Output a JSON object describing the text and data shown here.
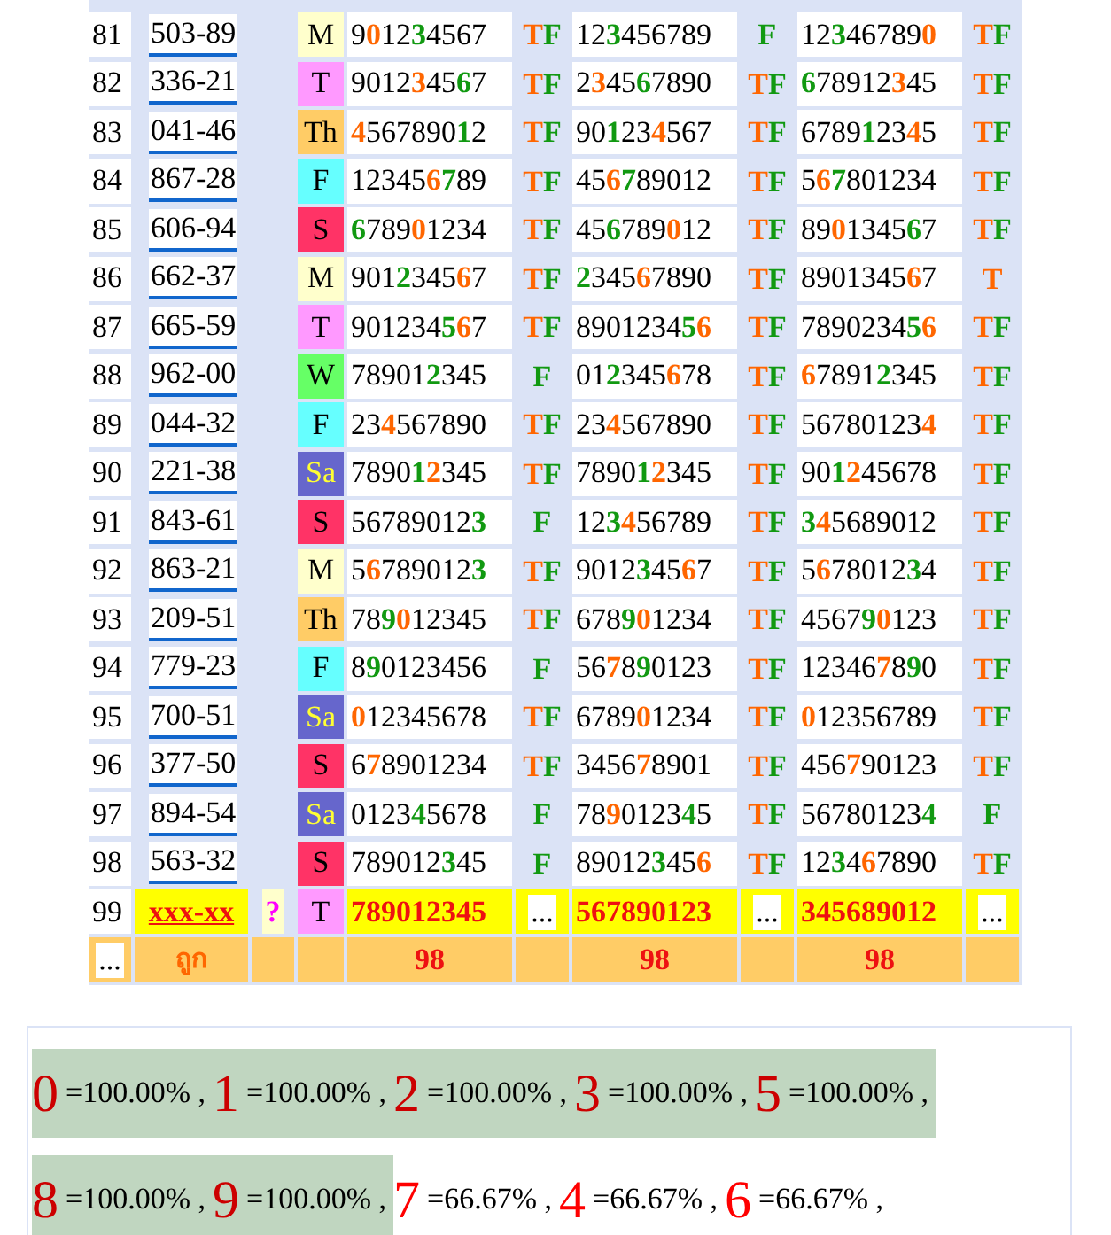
{
  "rows": [
    {
      "no": "81",
      "num": "503-89",
      "day": "M",
      "color": "#ffffcc",
      "nums": [
        [
          {
            "text": "9",
            "kind": "plain"
          },
          {
            "text": "0",
            "kind": "hot"
          },
          {
            "text": "12",
            "kind": "plain"
          },
          {
            "text": "3",
            "kind": "cold"
          },
          {
            "text": "4567",
            "kind": "plain"
          }
        ],
        [
          {
            "text": "12",
            "kind": "plain"
          },
          {
            "text": "3",
            "kind": "cold"
          },
          {
            "text": "456789",
            "kind": "plain"
          }
        ],
        [
          {
            "text": "12",
            "kind": "plain"
          },
          {
            "text": "3",
            "kind": "cold"
          },
          {
            "text": "46789",
            "kind": "plain"
          },
          {
            "text": "0",
            "kind": "hot"
          }
        ]
      ],
      "marks": [
        {
          "t": "T",
          "f": "F"
        },
        {
          "f": "F"
        },
        {
          "t": "T",
          "f": "F"
        }
      ]
    },
    {
      "no": "82",
      "num": "336-21",
      "day": "T",
      "color": "#ff99ff",
      "nums": [
        [
          {
            "text": "9012",
            "kind": "plain"
          },
          {
            "text": "3",
            "kind": "hot"
          },
          {
            "text": "45",
            "kind": "plain"
          },
          {
            "text": "6",
            "kind": "cold"
          },
          {
            "text": "7",
            "kind": "plain"
          }
        ],
        [
          {
            "text": "2",
            "kind": "plain"
          },
          {
            "text": "3",
            "kind": "hot"
          },
          {
            "text": "45",
            "kind": "plain"
          },
          {
            "text": "6",
            "kind": "cold"
          },
          {
            "text": "7890",
            "kind": "plain"
          }
        ],
        [
          {
            "text": "6",
            "kind": "cold"
          },
          {
            "text": "78912",
            "kind": "plain"
          },
          {
            "text": "3",
            "kind": "hot"
          },
          {
            "text": "45",
            "kind": "plain"
          }
        ]
      ],
      "marks": [
        {
          "t": "T",
          "f": "F"
        },
        {
          "t": "T",
          "f": "F"
        },
        {
          "t": "T",
          "f": "F"
        }
      ]
    },
    {
      "no": "83",
      "num": "041-46",
      "day": "Th",
      "color": "#ffcc66",
      "nums": [
        [
          {
            "text": "4",
            "kind": "hot"
          },
          {
            "text": "567890",
            "kind": "plain"
          },
          {
            "text": "1",
            "kind": "cold"
          },
          {
            "text": "2",
            "kind": "plain"
          }
        ],
        [
          {
            "text": "90",
            "kind": "plain"
          },
          {
            "text": "1",
            "kind": "cold"
          },
          {
            "text": "23",
            "kind": "plain"
          },
          {
            "text": "4",
            "kind": "hot"
          },
          {
            "text": "567",
            "kind": "plain"
          }
        ],
        [
          {
            "text": "6789",
            "kind": "plain"
          },
          {
            "text": "1",
            "kind": "cold"
          },
          {
            "text": "23",
            "kind": "plain"
          },
          {
            "text": "4",
            "kind": "hot"
          },
          {
            "text": "5",
            "kind": "plain"
          }
        ]
      ],
      "marks": [
        {
          "t": "T",
          "f": "F"
        },
        {
          "t": "T",
          "f": "F"
        },
        {
          "t": "T",
          "f": "F"
        }
      ]
    },
    {
      "no": "84",
      "num": "867-28",
      "day": "F",
      "color": "#66ffff",
      "nums": [
        [
          {
            "text": "12345",
            "kind": "plain"
          },
          {
            "text": "6",
            "kind": "hot"
          },
          {
            "text": "7",
            "kind": "cold"
          },
          {
            "text": "89",
            "kind": "plain"
          }
        ],
        [
          {
            "text": "45",
            "kind": "plain"
          },
          {
            "text": "6",
            "kind": "hot"
          },
          {
            "text": "7",
            "kind": "cold"
          },
          {
            "text": "89012",
            "kind": "plain"
          }
        ],
        [
          {
            "text": "5",
            "kind": "plain"
          },
          {
            "text": "6",
            "kind": "hot"
          },
          {
            "text": "7",
            "kind": "cold"
          },
          {
            "text": "801234",
            "kind": "plain"
          }
        ]
      ],
      "marks": [
        {
          "t": "T",
          "f": "F"
        },
        {
          "t": "T",
          "f": "F"
        },
        {
          "t": "T",
          "f": "F"
        }
      ]
    },
    {
      "no": "85",
      "num": "606-94",
      "day": "S",
      "color": "#ff3366",
      "nums": [
        [
          {
            "text": "6",
            "kind": "cold"
          },
          {
            "text": "789",
            "kind": "plain"
          },
          {
            "text": "0",
            "kind": "hot"
          },
          {
            "text": "1234",
            "kind": "plain"
          }
        ],
        [
          {
            "text": "45",
            "kind": "plain"
          },
          {
            "text": "6",
            "kind": "cold"
          },
          {
            "text": "789",
            "kind": "plain"
          },
          {
            "text": "0",
            "kind": "hot"
          },
          {
            "text": "12",
            "kind": "plain"
          }
        ],
        [
          {
            "text": "89",
            "kind": "plain"
          },
          {
            "text": "0",
            "kind": "hot"
          },
          {
            "text": "1345",
            "kind": "plain"
          },
          {
            "text": "6",
            "kind": "cold"
          },
          {
            "text": "7",
            "kind": "plain"
          }
        ]
      ],
      "marks": [
        {
          "t": "T",
          "f": "F"
        },
        {
          "t": "T",
          "f": "F"
        },
        {
          "t": "T",
          "f": "F"
        }
      ]
    },
    {
      "no": "86",
      "num": "662-37",
      "day": "M",
      "color": "#ffffcc",
      "nums": [
        [
          {
            "text": "901",
            "kind": "plain"
          },
          {
            "text": "2",
            "kind": "cold"
          },
          {
            "text": "345",
            "kind": "plain"
          },
          {
            "text": "6",
            "kind": "hot"
          },
          {
            "text": "7",
            "kind": "plain"
          }
        ],
        [
          {
            "text": "2",
            "kind": "cold"
          },
          {
            "text": "345",
            "kind": "plain"
          },
          {
            "text": "6",
            "kind": "hot"
          },
          {
            "text": "7890",
            "kind": "plain"
          }
        ],
        [
          {
            "text": "8901345",
            "kind": "plain"
          },
          {
            "text": "6",
            "kind": "hot"
          },
          {
            "text": "7",
            "kind": "plain"
          }
        ]
      ],
      "marks": [
        {
          "t": "T",
          "f": "F"
        },
        {
          "t": "T",
          "f": "F"
        },
        {
          "t": "T"
        }
      ]
    },
    {
      "no": "87",
      "num": "665-59",
      "day": "T",
      "color": "#ff99ff",
      "nums": [
        [
          {
            "text": "901234",
            "kind": "plain"
          },
          {
            "text": "5",
            "kind": "cold"
          },
          {
            "text": "6",
            "kind": "hot"
          },
          {
            "text": "7",
            "kind": "plain"
          }
        ],
        [
          {
            "text": "8901234",
            "kind": "plain"
          },
          {
            "text": "5",
            "kind": "cold"
          },
          {
            "text": "6",
            "kind": "hot"
          }
        ],
        [
          {
            "text": "7890234",
            "kind": "plain"
          },
          {
            "text": "5",
            "kind": "cold"
          },
          {
            "text": "6",
            "kind": "hot"
          }
        ]
      ],
      "marks": [
        {
          "t": "T",
          "f": "F"
        },
        {
          "t": "T",
          "f": "F"
        },
        {
          "t": "T",
          "f": "F"
        }
      ]
    },
    {
      "no": "88",
      "num": "962-00",
      "day": "W",
      "color": "#66ff66",
      "nums": [
        [
          {
            "text": "78901",
            "kind": "plain"
          },
          {
            "text": "2",
            "kind": "cold"
          },
          {
            "text": "345",
            "kind": "plain"
          }
        ],
        [
          {
            "text": "01",
            "kind": "plain"
          },
          {
            "text": "2",
            "kind": "cold"
          },
          {
            "text": "345",
            "kind": "plain"
          },
          {
            "text": "6",
            "kind": "hot"
          },
          {
            "text": "78",
            "kind": "plain"
          }
        ],
        [
          {
            "text": "6",
            "kind": "hot"
          },
          {
            "text": "7891",
            "kind": "plain"
          },
          {
            "text": "2",
            "kind": "cold"
          },
          {
            "text": "345",
            "kind": "plain"
          }
        ]
      ],
      "marks": [
        {
          "f": "F"
        },
        {
          "t": "T",
          "f": "F"
        },
        {
          "t": "T",
          "f": "F"
        }
      ]
    },
    {
      "no": "89",
      "num": "044-32",
      "day": "F",
      "color": "#66ffff",
      "nums": [
        [
          {
            "text": "23",
            "kind": "plain"
          },
          {
            "text": "4",
            "kind": "hot"
          },
          {
            "text": "567890",
            "kind": "plain"
          }
        ],
        [
          {
            "text": "23",
            "kind": "plain"
          },
          {
            "text": "4",
            "kind": "hot"
          },
          {
            "text": "567890",
            "kind": "plain"
          }
        ],
        [
          {
            "text": "56780123",
            "kind": "plain"
          },
          {
            "text": "4",
            "kind": "hot"
          }
        ]
      ],
      "marks": [
        {
          "t": "T",
          "f": "F"
        },
        {
          "t": "T",
          "f": "F"
        },
        {
          "t": "T",
          "f": "F"
        }
      ]
    },
    {
      "no": "90",
      "num": "221-38",
      "day": "Sa",
      "color": "#6666cc",
      "nums": [
        [
          {
            "text": "7890",
            "kind": "plain"
          },
          {
            "text": "1",
            "kind": "cold"
          },
          {
            "text": "2",
            "kind": "hot"
          },
          {
            "text": "345",
            "kind": "plain"
          }
        ],
        [
          {
            "text": "7890",
            "kind": "plain"
          },
          {
            "text": "1",
            "kind": "cold"
          },
          {
            "text": "2",
            "kind": "hot"
          },
          {
            "text": "345",
            "kind": "plain"
          }
        ],
        [
          {
            "text": "90",
            "kind": "plain"
          },
          {
            "text": "1",
            "kind": "cold"
          },
          {
            "text": "2",
            "kind": "hot"
          },
          {
            "text": "45678",
            "kind": "plain"
          }
        ]
      ],
      "marks": [
        {
          "t": "T",
          "f": "F"
        },
        {
          "t": "T",
          "f": "F"
        },
        {
          "t": "T",
          "f": "F"
        }
      ]
    },
    {
      "no": "91",
      "num": "843-61",
      "day": "S",
      "color": "#ff3366",
      "nums": [
        [
          {
            "text": "56789012",
            "kind": "plain"
          },
          {
            "text": "3",
            "kind": "cold"
          }
        ],
        [
          {
            "text": "12",
            "kind": "plain"
          },
          {
            "text": "3",
            "kind": "cold"
          },
          {
            "text": "4",
            "kind": "hot"
          },
          {
            "text": "56789",
            "kind": "plain"
          }
        ],
        [
          {
            "text": "3",
            "kind": "cold"
          },
          {
            "text": "4",
            "kind": "hot"
          },
          {
            "text": "5689012",
            "kind": "plain"
          }
        ]
      ],
      "marks": [
        {
          "f": "F"
        },
        {
          "t": "T",
          "f": "F"
        },
        {
          "t": "T",
          "f": "F"
        }
      ]
    },
    {
      "no": "92",
      "num": "863-21",
      "day": "M",
      "color": "#ffffcc",
      "nums": [
        [
          {
            "text": "5",
            "kind": "plain"
          },
          {
            "text": "6",
            "kind": "hot"
          },
          {
            "text": "789012",
            "kind": "plain"
          },
          {
            "text": "3",
            "kind": "cold"
          }
        ],
        [
          {
            "text": "9012",
            "kind": "plain"
          },
          {
            "text": "3",
            "kind": "cold"
          },
          {
            "text": "45",
            "kind": "plain"
          },
          {
            "text": "6",
            "kind": "hot"
          },
          {
            "text": "7",
            "kind": "plain"
          }
        ],
        [
          {
            "text": "5",
            "kind": "plain"
          },
          {
            "text": "6",
            "kind": "hot"
          },
          {
            "text": "78012",
            "kind": "plain"
          },
          {
            "text": "3",
            "kind": "cold"
          },
          {
            "text": "4",
            "kind": "plain"
          }
        ]
      ],
      "marks": [
        {
          "t": "T",
          "f": "F"
        },
        {
          "t": "T",
          "f": "F"
        },
        {
          "t": "T",
          "f": "F"
        }
      ]
    },
    {
      "no": "93",
      "num": "209-51",
      "day": "Th",
      "color": "#ffcc66",
      "nums": [
        [
          {
            "text": "78",
            "kind": "plain"
          },
          {
            "text": "9",
            "kind": "cold"
          },
          {
            "text": "0",
            "kind": "hot"
          },
          {
            "text": "12345",
            "kind": "plain"
          }
        ],
        [
          {
            "text": "678",
            "kind": "plain"
          },
          {
            "text": "9",
            "kind": "cold"
          },
          {
            "text": "0",
            "kind": "hot"
          },
          {
            "text": "1234",
            "kind": "plain"
          }
        ],
        [
          {
            "text": "4567",
            "kind": "plain"
          },
          {
            "text": "9",
            "kind": "cold"
          },
          {
            "text": "0",
            "kind": "hot"
          },
          {
            "text": "123",
            "kind": "plain"
          }
        ]
      ],
      "marks": [
        {
          "t": "T",
          "f": "F"
        },
        {
          "t": "T",
          "f": "F"
        },
        {
          "t": "T",
          "f": "F"
        }
      ]
    },
    {
      "no": "94",
      "num": "779-23",
      "day": "F",
      "color": "#66ffff",
      "nums": [
        [
          {
            "text": "8",
            "kind": "plain"
          },
          {
            "text": "9",
            "kind": "cold"
          },
          {
            "text": "0123456",
            "kind": "plain"
          }
        ],
        [
          {
            "text": "56",
            "kind": "plain"
          },
          {
            "text": "7",
            "kind": "hot"
          },
          {
            "text": "8",
            "kind": "plain"
          },
          {
            "text": "9",
            "kind": "cold"
          },
          {
            "text": "0123",
            "kind": "plain"
          }
        ],
        [
          {
            "text": "12346",
            "kind": "plain"
          },
          {
            "text": "7",
            "kind": "hot"
          },
          {
            "text": "8",
            "kind": "plain"
          },
          {
            "text": "9",
            "kind": "cold"
          },
          {
            "text": "0",
            "kind": "plain"
          }
        ]
      ],
      "marks": [
        {
          "f": "F"
        },
        {
          "t": "T",
          "f": "F"
        },
        {
          "t": "T",
          "f": "F"
        }
      ]
    },
    {
      "no": "95",
      "num": "700-51",
      "day": "Sa",
      "color": "#6666cc",
      "nums": [
        [
          {
            "text": "0",
            "kind": "hot"
          },
          {
            "text": "12345678",
            "kind": "plain"
          }
        ],
        [
          {
            "text": "6789",
            "kind": "plain"
          },
          {
            "text": "0",
            "kind": "hot"
          },
          {
            "text": "1234",
            "kind": "plain"
          }
        ],
        [
          {
            "text": "0",
            "kind": "hot"
          },
          {
            "text": "12356789",
            "kind": "plain"
          }
        ]
      ],
      "marks": [
        {
          "t": "T",
          "f": "F"
        },
        {
          "t": "T",
          "f": "F"
        },
        {
          "t": "T",
          "f": "F"
        }
      ]
    },
    {
      "no": "96",
      "num": "377-50",
      "day": "S",
      "color": "#ff3366",
      "nums": [
        [
          {
            "text": "6",
            "kind": "plain"
          },
          {
            "text": "7",
            "kind": "hot"
          },
          {
            "text": "8901234",
            "kind": "plain"
          }
        ],
        [
          {
            "text": "3456",
            "kind": "plain"
          },
          {
            "text": "7",
            "kind": "hot"
          },
          {
            "text": "8901",
            "kind": "plain"
          }
        ],
        [
          {
            "text": "456",
            "kind": "plain"
          },
          {
            "text": "7",
            "kind": "hot"
          },
          {
            "text": "90123",
            "kind": "plain"
          }
        ]
      ],
      "marks": [
        {
          "t": "T",
          "f": "F"
        },
        {
          "t": "T",
          "f": "F"
        },
        {
          "t": "T",
          "f": "F"
        }
      ]
    },
    {
      "no": "97",
      "num": "894-54",
      "day": "Sa",
      "color": "#6666cc",
      "nums": [
        [
          {
            "text": "0123",
            "kind": "plain"
          },
          {
            "text": "4",
            "kind": "cold"
          },
          {
            "text": "5678",
            "kind": "plain"
          }
        ],
        [
          {
            "text": "78",
            "kind": "plain"
          },
          {
            "text": "9",
            "kind": "hot"
          },
          {
            "text": "0123",
            "kind": "plain"
          },
          {
            "text": "4",
            "kind": "cold"
          },
          {
            "text": "5",
            "kind": "plain"
          }
        ],
        [
          {
            "text": "5678012",
            "kind": "plain"
          },
          {
            "text": "3",
            "kind": "plain"
          },
          {
            "text": "4",
            "kind": "cold"
          }
        ]
      ],
      "marks": [
        {
          "f": "F"
        },
        {
          "t": "T",
          "f": "F"
        },
        {
          "f": "F"
        }
      ]
    },
    {
      "no": "98",
      "num": "563-32",
      "day": "S",
      "color": "#ff3366",
      "nums": [
        [
          {
            "text": "789012",
            "kind": "plain"
          },
          {
            "text": "3",
            "kind": "cold"
          },
          {
            "text": "45",
            "kind": "plain"
          }
        ],
        [
          {
            "text": "89012",
            "kind": "plain"
          },
          {
            "text": "3",
            "kind": "cold"
          },
          {
            "text": "45",
            "kind": "plain"
          },
          {
            "text": "6",
            "kind": "hot"
          }
        ],
        [
          {
            "text": "12",
            "kind": "plain"
          },
          {
            "text": "3",
            "kind": "cold"
          },
          {
            "text": "4",
            "kind": "plain"
          },
          {
            "text": "6",
            "kind": "hot"
          },
          {
            "text": "7890",
            "kind": "plain"
          }
        ]
      ],
      "marks": [
        {
          "f": "F"
        },
        {
          "t": "T",
          "f": "F"
        },
        {
          "t": "T",
          "f": "F"
        }
      ]
    }
  ],
  "pending": {
    "no": "99",
    "num": "xxx-xx",
    "flag": "?",
    "day": "T",
    "color": "#ff99ff",
    "nums": [
      "789012345",
      "567890123",
      "345689012"
    ],
    "marks": [
      "...",
      "...",
      "..."
    ]
  },
  "footer": {
    "first": "...",
    "label": "ถูก",
    "counts": [
      "98",
      "98",
      "98"
    ]
  },
  "summary": [
    {
      "digit": "0",
      "text": "=100.00% ,",
      "highlighted": true
    },
    {
      "digit": "1",
      "text": "=100.00% ,",
      "highlighted": true
    },
    {
      "digit": "2",
      "text": "=100.00% ,",
      "highlighted": true
    },
    {
      "digit": "3",
      "text": "=100.00% ,",
      "highlighted": true
    },
    {
      "digit": "5",
      "text": "=100.00% ,",
      "highlighted": true
    },
    {
      "digit": "8",
      "text": "=100.00% ,",
      "highlighted": true
    },
    {
      "digit": "9",
      "text": "=100.00% ,",
      "highlighted": true
    },
    {
      "digit": "7",
      "text": "=66.67% ,",
      "highlighted": false
    },
    {
      "digit": "4",
      "text": "=66.67% ,",
      "highlighted": false
    },
    {
      "digit": "6",
      "text": "=66.67% ,",
      "highlighted": false
    }
  ]
}
